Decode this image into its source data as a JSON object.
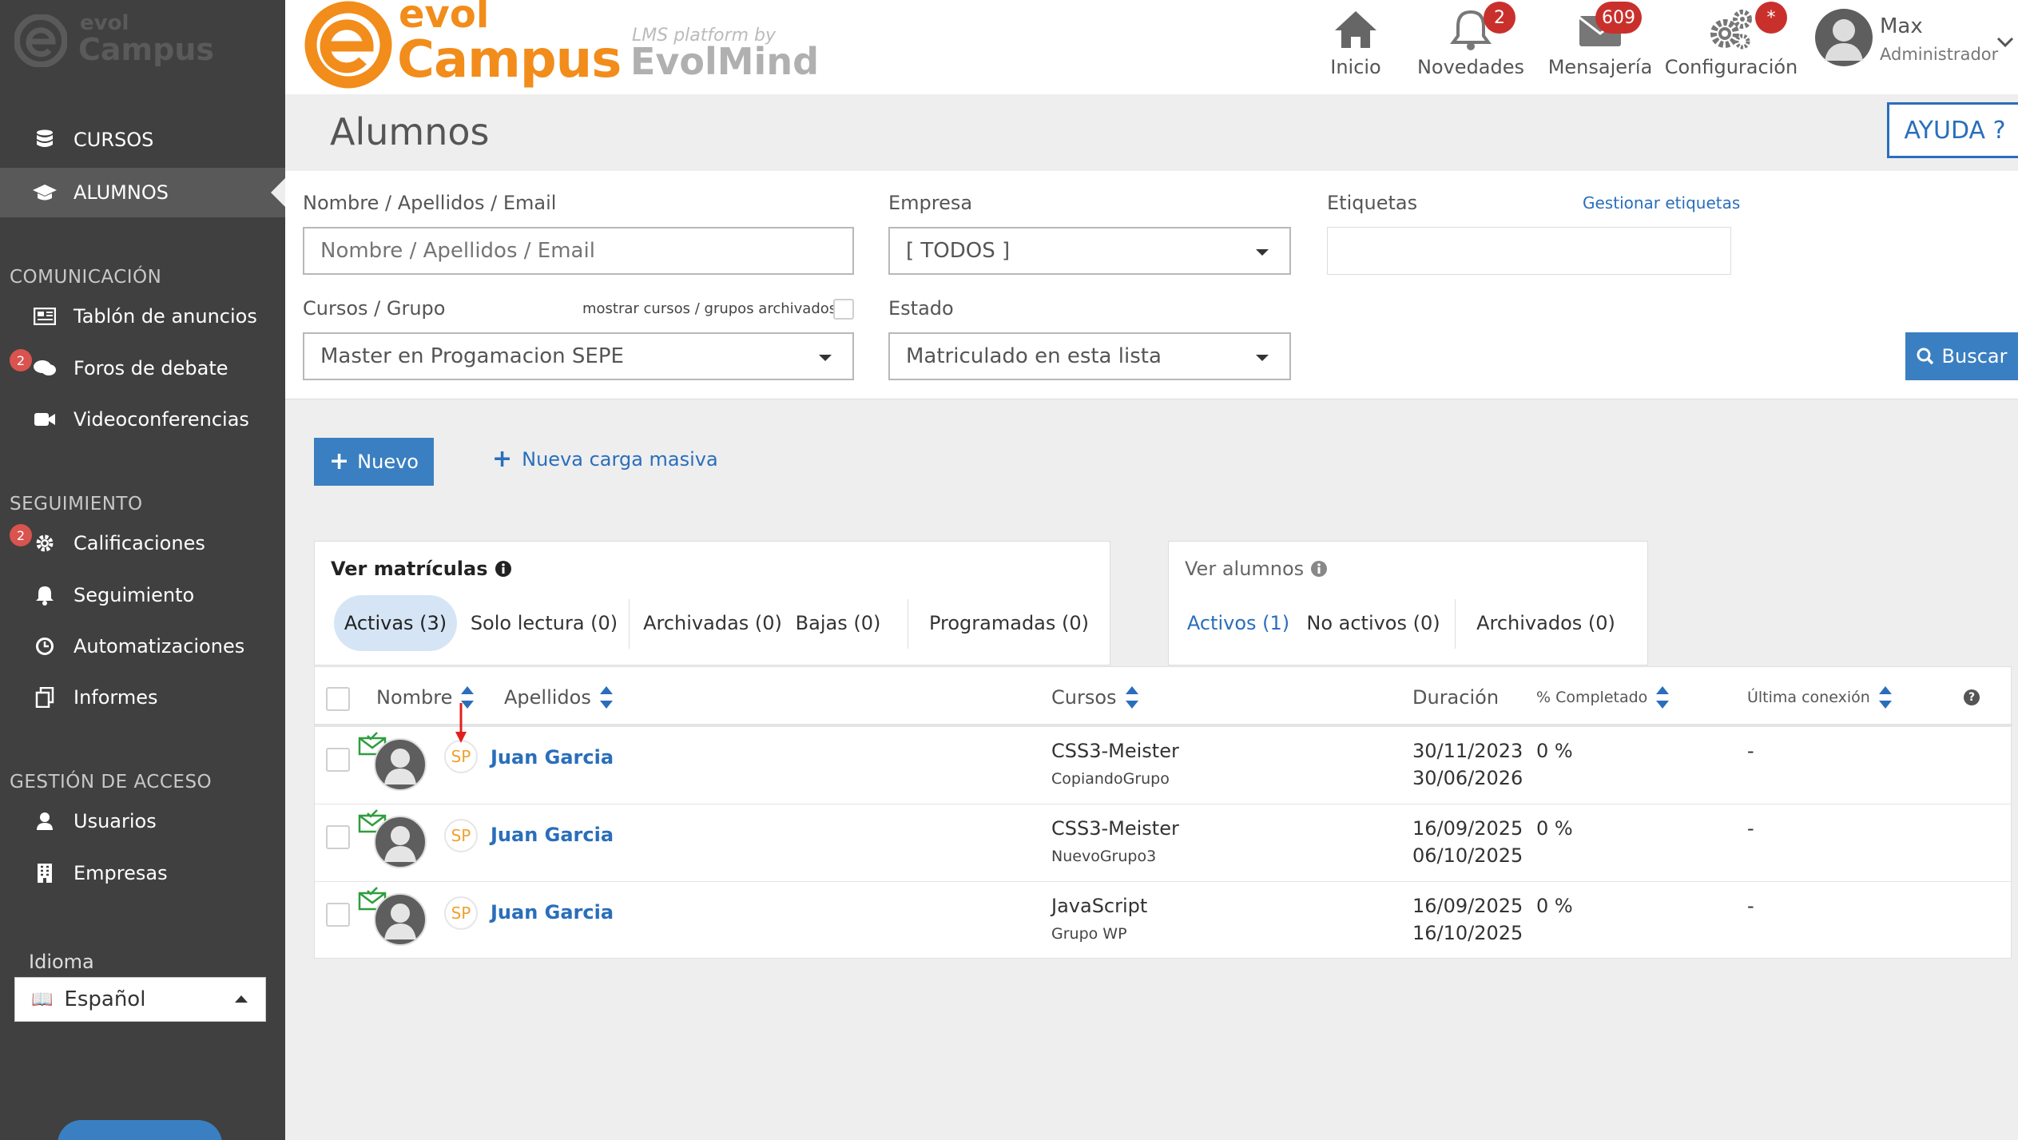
{
  "sidebar": {
    "logo_top": "evol",
    "logo_bottom": "Campus",
    "menu": [
      {
        "label": "CURSOS",
        "icon": "database-icon"
      },
      {
        "label": "ALUMNOS",
        "icon": "graduation-cap-icon"
      }
    ],
    "sections": [
      {
        "title": "COMUNICACIÓN",
        "items": [
          {
            "label": "Tablón de anuncios",
            "icon": "newspaper-icon",
            "badge": ""
          },
          {
            "label": "Foros de debate",
            "icon": "comments-icon",
            "badge": "2"
          },
          {
            "label": "Videoconferencias",
            "icon": "video-camera-icon",
            "badge": ""
          }
        ]
      },
      {
        "title": "SEGUIMIENTO",
        "items": [
          {
            "label": "Calificaciones",
            "icon": "cog-icon",
            "badge": "2"
          },
          {
            "label": "Seguimiento",
            "icon": "bell-icon",
            "badge": ""
          },
          {
            "label": "Automatizaciones",
            "icon": "clock-icon",
            "badge": ""
          },
          {
            "label": "Informes",
            "icon": "copy-icon",
            "badge": ""
          }
        ]
      },
      {
        "title": "GESTIÓN DE ACCESO",
        "items": [
          {
            "label": "Usuarios",
            "icon": "user-icon",
            "badge": ""
          },
          {
            "label": "Empresas",
            "icon": "building-icon",
            "badge": ""
          }
        ]
      }
    ],
    "language_label": "Idioma",
    "language_value": "Español"
  },
  "header": {
    "brand_evol": "evol",
    "brand_campus": "Campus",
    "tagline_small": "LMS platform by",
    "tagline_big": "EvolMind",
    "nav": [
      {
        "label": "Inicio",
        "icon": "home-icon",
        "badge": ""
      },
      {
        "label": "Novedades",
        "icon": "bell-icon",
        "badge": "2"
      },
      {
        "label": "Mensajería",
        "icon": "envelope-icon",
        "badge": "609"
      },
      {
        "label": "Configuración",
        "icon": "gears-icon",
        "badge": "*"
      }
    ],
    "user_name": "Max",
    "user_role": "Administrador"
  },
  "page": {
    "title": "Alumnos",
    "help_button": "AYUDA ?"
  },
  "filters": {
    "name_label": "Nombre / Apellidos / Email",
    "name_placeholder": "Nombre / Apellidos / Email",
    "company_label": "Empresa",
    "company_value": "[ TODOS ]",
    "tags_label": "Etiquetas",
    "manage_tags_link": "Gestionar etiquetas",
    "courses_label": "Cursos / Grupo",
    "show_archived_label": "mostrar cursos / grupos archivados",
    "courses_value": "Master en Progamacion SEPE",
    "state_label": "Estado",
    "state_value": "Matriculado en esta lista",
    "search_button": "Buscar"
  },
  "actions": {
    "new_button": "Nuevo",
    "bulk_link": "Nueva carga masiva"
  },
  "enrollments_card": {
    "title": "Ver matrículas",
    "tabs": [
      "Activas (3)",
      "Solo lectura (0)",
      "Archivadas (0)",
      "Bajas (0)",
      "Programadas (0)"
    ]
  },
  "students_card": {
    "title": "Ver alumnos",
    "tabs": [
      "Activos (1)",
      "No activos (0)",
      "Archivados (0)"
    ]
  },
  "table": {
    "columns": {
      "nombre": "Nombre",
      "apellidos": "Apellidos",
      "cursos": "Cursos",
      "duracion": "Duración",
      "completado": "% Completado",
      "conexion": "Última conexión",
      "help": "?"
    },
    "rows": [
      {
        "initials": "SP",
        "name": "Juan Garcia",
        "course": "CSS3-Meister",
        "group": "CopiandoGrupo",
        "start": "30/11/2023",
        "end": "30/06/2026",
        "completed": "0 %",
        "last": "-"
      },
      {
        "initials": "SP",
        "name": "Juan Garcia",
        "course": "CSS3-Meister",
        "group": "NuevoGrupo3",
        "start": "16/09/2025",
        "end": "06/10/2025",
        "completed": "0 %",
        "last": "-"
      },
      {
        "initials": "SP",
        "name": "Juan Garcia",
        "course": "JavaScript",
        "group": "Grupo WP",
        "start": "16/09/2025",
        "end": "16/10/2025",
        "completed": "0 %",
        "last": "-"
      }
    ]
  },
  "colors": {
    "sidebar_bg": "#404040",
    "accent_blue": "#3a7fc1",
    "brand_orange": "#f28c1a",
    "badge_red": "#c9302c"
  }
}
